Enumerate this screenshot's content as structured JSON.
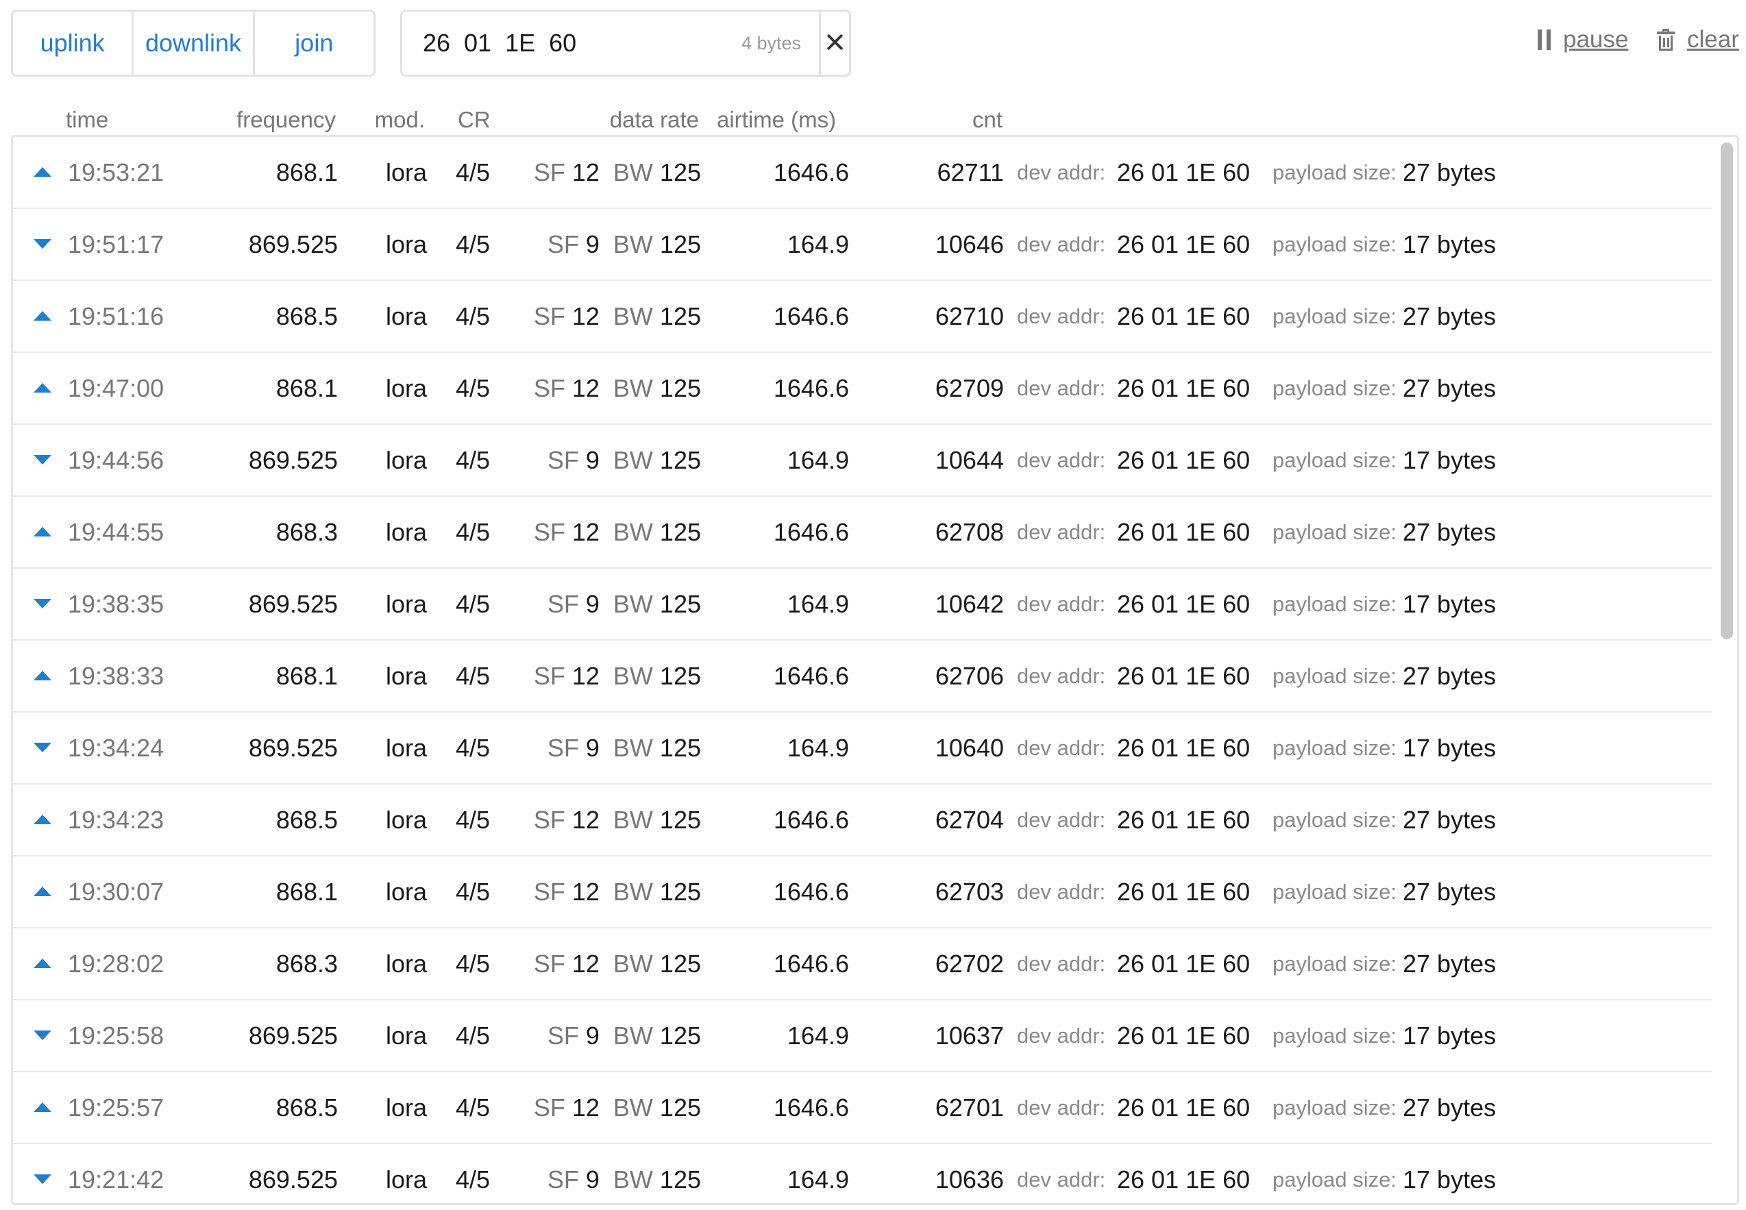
{
  "filters": {
    "uplink": "uplink",
    "downlink": "downlink",
    "join": "join"
  },
  "search": {
    "value": "26 01 1E 60",
    "count": "4 bytes",
    "clear_symbol": "✕"
  },
  "actions": {
    "pause": "pause",
    "clear": "clear"
  },
  "icons": {
    "pause": "pause-icon",
    "clear": "trash-icon",
    "uplink": "triangle-up",
    "downlink": "triangle-down"
  },
  "colors": {
    "accent": "#1d7fd0",
    "muted": "#777777",
    "border": "#e3e3e3"
  },
  "columns": {
    "time": "time",
    "frequency": "frequency",
    "mod": "mod.",
    "cr": "CR",
    "data_rate": "data rate",
    "airtime": "airtime (ms)",
    "cnt": "cnt"
  },
  "labels": {
    "sf": "SF",
    "bw": "BW",
    "dev_addr": "dev addr:",
    "payload_size": "payload size:"
  },
  "rows": [
    {
      "direction": "up",
      "time": "19:53:21",
      "frequency": "868.1",
      "mod": "lora",
      "cr": "4/5",
      "sf": "12",
      "bw": "125",
      "airtime": "1646.6",
      "cnt": "62711",
      "dev_addr": "26 01 1E 60",
      "payload_size": "27 bytes"
    },
    {
      "direction": "down",
      "time": "19:51:17",
      "frequency": "869.525",
      "mod": "lora",
      "cr": "4/5",
      "sf": "9",
      "bw": "125",
      "airtime": "164.9",
      "cnt": "10646",
      "dev_addr": "26 01 1E 60",
      "payload_size": "17 bytes"
    },
    {
      "direction": "up",
      "time": "19:51:16",
      "frequency": "868.5",
      "mod": "lora",
      "cr": "4/5",
      "sf": "12",
      "bw": "125",
      "airtime": "1646.6",
      "cnt": "62710",
      "dev_addr": "26 01 1E 60",
      "payload_size": "27 bytes"
    },
    {
      "direction": "up",
      "time": "19:47:00",
      "frequency": "868.1",
      "mod": "lora",
      "cr": "4/5",
      "sf": "12",
      "bw": "125",
      "airtime": "1646.6",
      "cnt": "62709",
      "dev_addr": "26 01 1E 60",
      "payload_size": "27 bytes"
    },
    {
      "direction": "down",
      "time": "19:44:56",
      "frequency": "869.525",
      "mod": "lora",
      "cr": "4/5",
      "sf": "9",
      "bw": "125",
      "airtime": "164.9",
      "cnt": "10644",
      "dev_addr": "26 01 1E 60",
      "payload_size": "17 bytes"
    },
    {
      "direction": "up",
      "time": "19:44:55",
      "frequency": "868.3",
      "mod": "lora",
      "cr": "4/5",
      "sf": "12",
      "bw": "125",
      "airtime": "1646.6",
      "cnt": "62708",
      "dev_addr": "26 01 1E 60",
      "payload_size": "27 bytes"
    },
    {
      "direction": "down",
      "time": "19:38:35",
      "frequency": "869.525",
      "mod": "lora",
      "cr": "4/5",
      "sf": "9",
      "bw": "125",
      "airtime": "164.9",
      "cnt": "10642",
      "dev_addr": "26 01 1E 60",
      "payload_size": "17 bytes"
    },
    {
      "direction": "up",
      "time": "19:38:33",
      "frequency": "868.1",
      "mod": "lora",
      "cr": "4/5",
      "sf": "12",
      "bw": "125",
      "airtime": "1646.6",
      "cnt": "62706",
      "dev_addr": "26 01 1E 60",
      "payload_size": "27 bytes"
    },
    {
      "direction": "down",
      "time": "19:34:24",
      "frequency": "869.525",
      "mod": "lora",
      "cr": "4/5",
      "sf": "9",
      "bw": "125",
      "airtime": "164.9",
      "cnt": "10640",
      "dev_addr": "26 01 1E 60",
      "payload_size": "17 bytes"
    },
    {
      "direction": "up",
      "time": "19:34:23",
      "frequency": "868.5",
      "mod": "lora",
      "cr": "4/5",
      "sf": "12",
      "bw": "125",
      "airtime": "1646.6",
      "cnt": "62704",
      "dev_addr": "26 01 1E 60",
      "payload_size": "27 bytes"
    },
    {
      "direction": "up",
      "time": "19:30:07",
      "frequency": "868.1",
      "mod": "lora",
      "cr": "4/5",
      "sf": "12",
      "bw": "125",
      "airtime": "1646.6",
      "cnt": "62703",
      "dev_addr": "26 01 1E 60",
      "payload_size": "27 bytes"
    },
    {
      "direction": "up",
      "time": "19:28:02",
      "frequency": "868.3",
      "mod": "lora",
      "cr": "4/5",
      "sf": "12",
      "bw": "125",
      "airtime": "1646.6",
      "cnt": "62702",
      "dev_addr": "26 01 1E 60",
      "payload_size": "27 bytes"
    },
    {
      "direction": "down",
      "time": "19:25:58",
      "frequency": "869.525",
      "mod": "lora",
      "cr": "4/5",
      "sf": "9",
      "bw": "125",
      "airtime": "164.9",
      "cnt": "10637",
      "dev_addr": "26 01 1E 60",
      "payload_size": "17 bytes"
    },
    {
      "direction": "up",
      "time": "19:25:57",
      "frequency": "868.5",
      "mod": "lora",
      "cr": "4/5",
      "sf": "12",
      "bw": "125",
      "airtime": "1646.6",
      "cnt": "62701",
      "dev_addr": "26 01 1E 60",
      "payload_size": "27 bytes"
    },
    {
      "direction": "down",
      "time": "19:21:42",
      "frequency": "869.525",
      "mod": "lora",
      "cr": "4/5",
      "sf": "9",
      "bw": "125",
      "airtime": "164.9",
      "cnt": "10636",
      "dev_addr": "26 01 1E 60",
      "payload_size": "17 bytes"
    }
  ]
}
